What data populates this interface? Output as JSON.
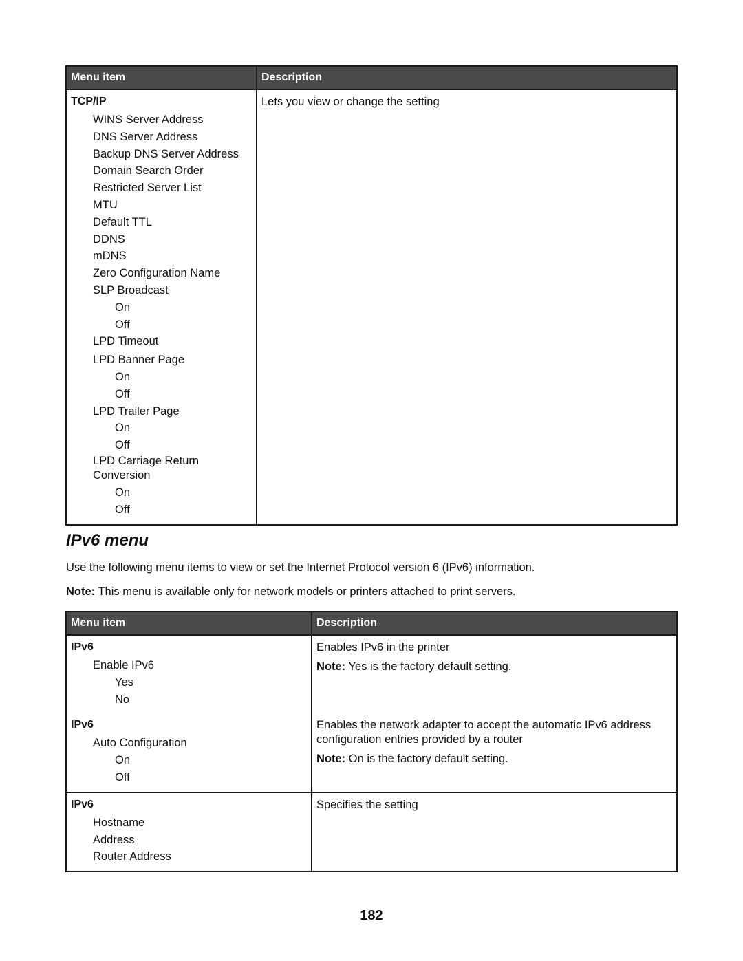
{
  "table1": {
    "headers": [
      "Menu item",
      "Description"
    ],
    "group": "TCP/IP",
    "description": "Lets you view or change the setting",
    "items": [
      {
        "label": "WINS Server Address",
        "level": 1
      },
      {
        "label": "DNS Server Address",
        "level": 1
      },
      {
        "label": "Backup DNS Server Address",
        "level": 1
      },
      {
        "label": "Domain Search Order",
        "level": 1
      },
      {
        "label": "Restricted Server List",
        "level": 1
      },
      {
        "label": "MTU",
        "level": 1
      },
      {
        "label": "Default TTL",
        "level": 1
      },
      {
        "label": "DDNS",
        "level": 1
      },
      {
        "label": "mDNS",
        "level": 1
      },
      {
        "label": "Zero Configuration Name",
        "level": 1
      },
      {
        "label": "SLP Broadcast",
        "level": 1
      },
      {
        "label": "On",
        "level": 2
      },
      {
        "label": "Off",
        "level": 2
      },
      {
        "label": "LPD Timeout",
        "level": 1
      },
      {
        "label": "LPD Banner Page",
        "level": 1
      },
      {
        "label": "On",
        "level": 2
      },
      {
        "label": "Off",
        "level": 2
      },
      {
        "label": "LPD Trailer Page",
        "level": 1
      },
      {
        "label": "On",
        "level": 2
      },
      {
        "label": "Off",
        "level": 2
      },
      {
        "label": "LPD Carriage Return Conversion",
        "level": 1
      },
      {
        "label": "On",
        "level": 2
      },
      {
        "label": "Off",
        "level": 2
      }
    ]
  },
  "section": {
    "title": "IPv6 menu",
    "intro": "Use the following menu items to view or set the Internet Protocol version 6 (IPv6) information.",
    "note_label": "Note:",
    "note_text": " This menu is available only for network models or printers attached to print servers."
  },
  "table2": {
    "headers": [
      "Menu item",
      "Description"
    ],
    "rows": [
      {
        "group": "IPv6",
        "items": [
          {
            "label": "Enable IPv6",
            "level": 1
          },
          {
            "label": "Yes",
            "level": 2
          },
          {
            "label": "No",
            "level": 2
          }
        ],
        "description": "Enables IPv6 in the printer",
        "note_label": "Note:",
        "note_text": " Yes is the factory default setting."
      },
      {
        "group": "IPv6",
        "items": [
          {
            "label": "Auto Configuration",
            "level": 1
          },
          {
            "label": "On",
            "level": 2
          },
          {
            "label": "Off",
            "level": 2
          }
        ],
        "description": "Enables the network adapter to accept the automatic IPv6 address configuration entries provided by a router",
        "note_label": "Note:",
        "note_text": " On is the factory default setting."
      },
      {
        "group": "IPv6",
        "items": [
          {
            "label": "Hostname",
            "level": 1
          },
          {
            "label": "Address",
            "level": 1
          },
          {
            "label": "Router Address",
            "level": 1
          }
        ],
        "description": "Specifies the setting"
      }
    ]
  },
  "page_number": "182"
}
